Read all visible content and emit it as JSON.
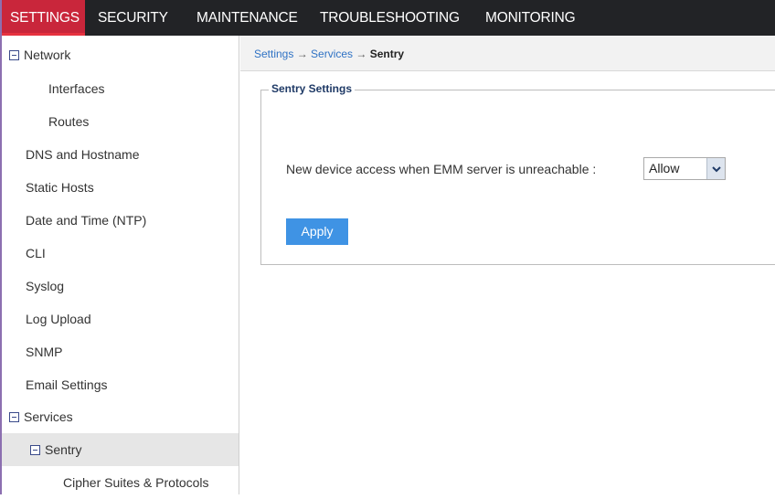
{
  "topnav": {
    "tabs": [
      {
        "label": "SETTINGS",
        "active": true
      },
      {
        "label": "SECURITY",
        "active": false
      },
      {
        "label": "MAINTENANCE",
        "active": false
      },
      {
        "label": "TROUBLESHOOTING",
        "active": false
      },
      {
        "label": "MONITORING",
        "active": false
      }
    ]
  },
  "sidebar": {
    "items": [
      {
        "label": "Network",
        "toggle": "collapse"
      },
      {
        "label": "Interfaces"
      },
      {
        "label": "Routes"
      },
      {
        "label": "DNS and Hostname"
      },
      {
        "label": "Static Hosts"
      },
      {
        "label": "Date and Time (NTP)"
      },
      {
        "label": "CLI"
      },
      {
        "label": "Syslog"
      },
      {
        "label": "Log Upload"
      },
      {
        "label": "SNMP"
      },
      {
        "label": "Email Settings"
      },
      {
        "label": "Services",
        "toggle": "collapse"
      },
      {
        "label": "Sentry",
        "toggle": "collapse",
        "selected": true
      },
      {
        "label": "Cipher Suites & Protocols"
      }
    ]
  },
  "breadcrumb": {
    "items": [
      "Settings",
      "Services"
    ],
    "separator": "→",
    "current": "Sentry"
  },
  "sentry": {
    "legend": "Sentry Settings",
    "field_label": "New device access when EMM server is unreachable :",
    "select_value": "Allow",
    "apply_label": "Apply"
  },
  "colors": {
    "accent": "#c9263b",
    "topnav_bg": "#222326",
    "link": "#2f72c4",
    "button": "#3f93e4"
  }
}
